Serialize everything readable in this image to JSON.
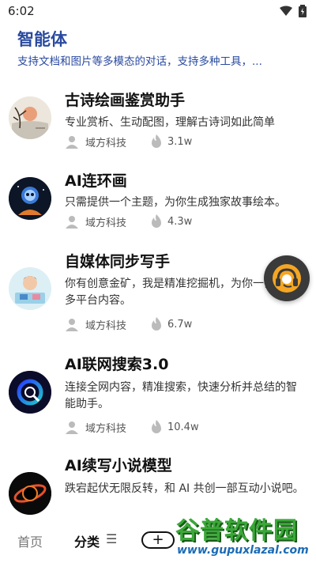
{
  "status_bar": {
    "time": "6:02"
  },
  "header": {
    "title": "智能体",
    "subtitle": "支持文档和图片等多模态的对话，支持多种工具，..."
  },
  "items": [
    {
      "title": "古诗绘画鉴赏助手",
      "desc": "专业赏析、生动配图，理解古诗词如此简单",
      "author": "域方科技",
      "views": "3.1w"
    },
    {
      "title": "AI连环画",
      "desc": "只需提供一个主题，为你生成独家故事绘本。",
      "author": "域方科技",
      "views": "4.3w"
    },
    {
      "title": "自媒体同步写手",
      "desc": "你有创意金矿，我是精准挖掘机，为你一键通发多平台内容。",
      "author": "域方科技",
      "views": "6.7w"
    },
    {
      "title": "AI联网搜索3.0",
      "desc": "连接全网内容，精准搜索，快速分析并总结的智能助手。",
      "author": "域方科技",
      "views": "10.4w"
    },
    {
      "title": "AI续写小说模型",
      "desc": "跌宕起伏无限反转，和 AI 共创一部互动小说吧。",
      "author": "",
      "views": ""
    }
  ],
  "bottom_nav": {
    "home": "首页",
    "category": "分类",
    "category_icon": "☰",
    "add": "+"
  },
  "watermark": {
    "main": "谷普软件园",
    "url": "www.gupuxlazal.com"
  },
  "colors": {
    "title_blue": "#2a4aa0",
    "fab_bg": "#3a3a3a",
    "fab_accent": "#f5a623"
  }
}
